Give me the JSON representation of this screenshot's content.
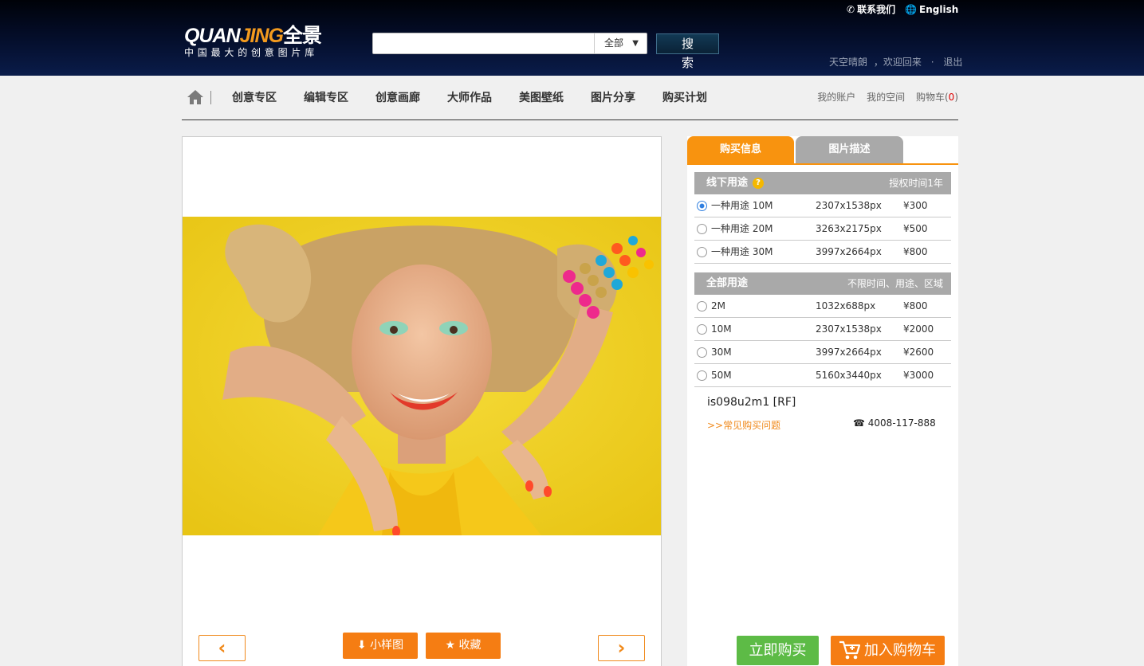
{
  "header": {
    "logo_main_a": "QUAN",
    "logo_main_b": "JING",
    "logo_main_c": "全景",
    "logo_sub": "中国最大的创意图片库",
    "search": {
      "value": "",
      "placeholder": "",
      "category": "全部",
      "button": "搜索"
    },
    "contact": "联系我们",
    "language": "English",
    "username": "天空晴朗",
    "welcome": "，欢迎回来",
    "dot": "·",
    "logout": "退出"
  },
  "nav": {
    "items": [
      "创意专区",
      "编辑专区",
      "创意画廊",
      "大师作品",
      "美图壁纸",
      "图片分享",
      "购买计划"
    ],
    "account": "我的账户",
    "space": "我的空间",
    "cart": "购物车",
    "cart_open": "(",
    "cart_count": "0",
    "cart_close": ")"
  },
  "image_panel": {
    "small_image": "小样图",
    "favorite": "收藏",
    "prev": "‹",
    "next": "›"
  },
  "purchase": {
    "tabs": [
      "购买信息",
      "图片描述"
    ],
    "offline": {
      "title": "线下用途",
      "note": "授权时间1年",
      "rows": [
        {
          "usage": "一种用途 10M",
          "size": "2307x1538px",
          "price": "¥300",
          "selected": true
        },
        {
          "usage": "一种用途 20M",
          "size": "3263x2175px",
          "price": "¥500",
          "selected": false
        },
        {
          "usage": "一种用途 30M",
          "size": "3997x2664px",
          "price": "¥800",
          "selected": false
        }
      ]
    },
    "all": {
      "title": "全部用途",
      "note": "不限时间、用途、区域",
      "rows": [
        {
          "usage": "2M",
          "size": "1032x688px",
          "price": "¥800",
          "selected": false
        },
        {
          "usage": "10M",
          "size": "2307x1538px",
          "price": "¥2000",
          "selected": false
        },
        {
          "usage": "30M",
          "size": "3997x2664px",
          "price": "¥2600",
          "selected": false
        },
        {
          "usage": "50M",
          "size": "5160x3440px",
          "price": "¥3000",
          "selected": false
        }
      ]
    },
    "image_code": "is098u2m1 [RF]",
    "faq": ">>常见购买问题",
    "phone_icon": "☎",
    "phone": "4008-117-888",
    "buy_now": "立即购买",
    "add_to_cart": "加入购物车"
  },
  "colors": {
    "accent_orange": "#f57d13",
    "tab_active": "#f8930f",
    "tab_inactive": "#a9a9a9",
    "buy_green": "#5dbb46",
    "header_bg": "#030b24"
  }
}
